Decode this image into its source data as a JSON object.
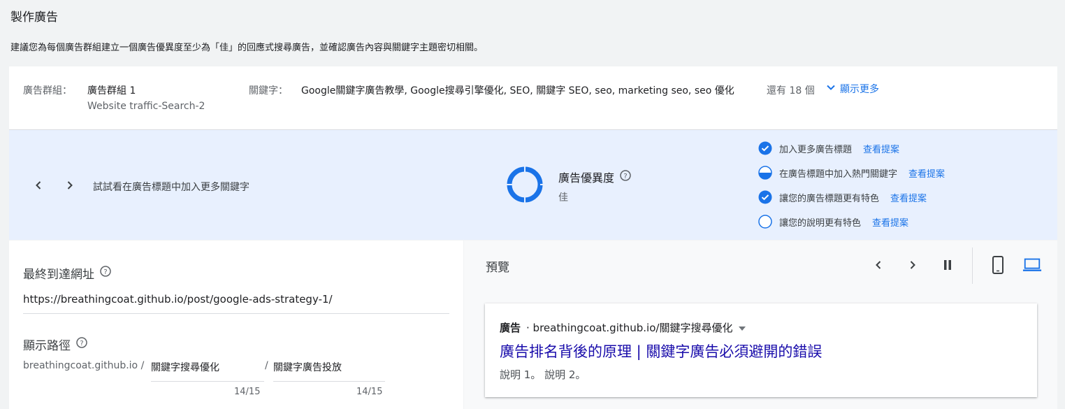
{
  "page": {
    "title": "製作廣告",
    "description": "建議您為每個廣告群組建立一個廣告優異度至少為「佳」的回應式搜尋廣告，並確認廣告內容與關鍵字主題密切相關。"
  },
  "ad_group": {
    "label": "廣告群組：",
    "name": "廣告群組 1",
    "campaign": "Website traffic-Search-2",
    "keywords_label": "關鍵字：",
    "keywords": "Google關鍵字廣告教學, Google搜尋引擎優化, SEO, 關鍵字 SEO, seo, marketing seo, seo 優化",
    "more_count": "還有 18 個",
    "show_more": "顯示更多"
  },
  "strength": {
    "tip": "試試看在廣告標題中加入更多關鍵字",
    "title": "廣告優異度",
    "value": "佳",
    "checklist": [
      {
        "text": "加入更多廣告標題",
        "link": "查看提案",
        "state": "done"
      },
      {
        "text": "在廣告標題中加入熱門關鍵字",
        "link": "查看提案",
        "state": "half"
      },
      {
        "text": "讓您的廣告標題更有特色",
        "link": "查看提案",
        "state": "done"
      },
      {
        "text": "讓您的說明更有特色",
        "link": "查看提案",
        "state": "empty"
      }
    ]
  },
  "form": {
    "final_url_label": "最終到達網址",
    "final_url": "https://breathingcoat.github.io/post/google-ads-strategy-1/",
    "display_path_label": "顯示路徑",
    "display_path_prefix": "breathingcoat.github.io /",
    "path1": "關鍵字搜尋優化",
    "path1_counter": "14/15",
    "path2_separator": "/",
    "path2": "關鍵字廣告投放",
    "path2_counter": "14/15"
  },
  "preview": {
    "title": "預覽",
    "ad_badge": "廣告",
    "display_url": "· breathingcoat.github.io/關鍵字搜尋優化",
    "headline": "廣告排名背後的原理 | 關鍵字廣告必須避開的錯誤",
    "description": "說明 1。 說明 2。"
  },
  "colors": {
    "accent": "#1a73e8",
    "band_bg": "#e8f0fe",
    "headline_link": "#1a0dab"
  }
}
